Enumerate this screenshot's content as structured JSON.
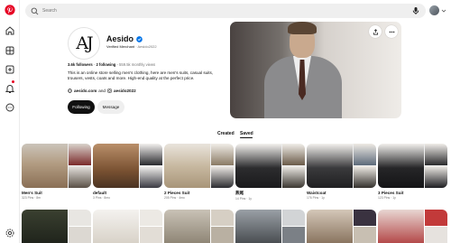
{
  "search": {
    "placeholder": "Search"
  },
  "profile": {
    "logo_text": "AJ",
    "name": "Aesido",
    "merchant_label": "Verified Merchant",
    "handle": "· Aesido2022",
    "followers": "3.6k followers",
    "following": "2 following",
    "monthly_views": "559.5k monthly views",
    "bio": "This is an online store selling men's clothing, here are men's suits, casual suits, trousers, vests, coats and more. High-end quality at the perfect price.",
    "website": "aesido.com",
    "and_word": "and",
    "instagram": "aesido2022",
    "following_button": "Following",
    "message_button": "Message"
  },
  "tabs": [
    {
      "label": "Created",
      "active": false
    },
    {
      "label": "Saved",
      "active": true
    }
  ],
  "boards": [
    {
      "title": "Men's Suit",
      "subtitle": "323 Pins · 8m"
    },
    {
      "title": "default",
      "subtitle": "3 Pins · 8mo"
    },
    {
      "title": "2 Pieces Suit",
      "subtitle": "205 Pins · 4mo"
    },
    {
      "title": "燕尾",
      "subtitle": "14 Pins · 1y"
    },
    {
      "title": "Waistcoat",
      "subtitle": "176 Pins · 1y"
    },
    {
      "title": "3 Pieces Suit",
      "subtitle": "123 Pins · 1y"
    }
  ],
  "icons": {
    "rail": [
      "pinterest-logo-icon",
      "home-icon",
      "explore-icon",
      "create-icon",
      "notifications-icon",
      "messages-icon",
      "settings-icon"
    ],
    "search": "search-icon",
    "mic": "microphone-icon",
    "share": "share-icon",
    "more": "more-icon",
    "verified": "verified-badge-icon"
  },
  "colors": {
    "brand": "#e60023",
    "verified": "#0074e8",
    "dark_button": "#111111",
    "light_button": "#efefef"
  }
}
